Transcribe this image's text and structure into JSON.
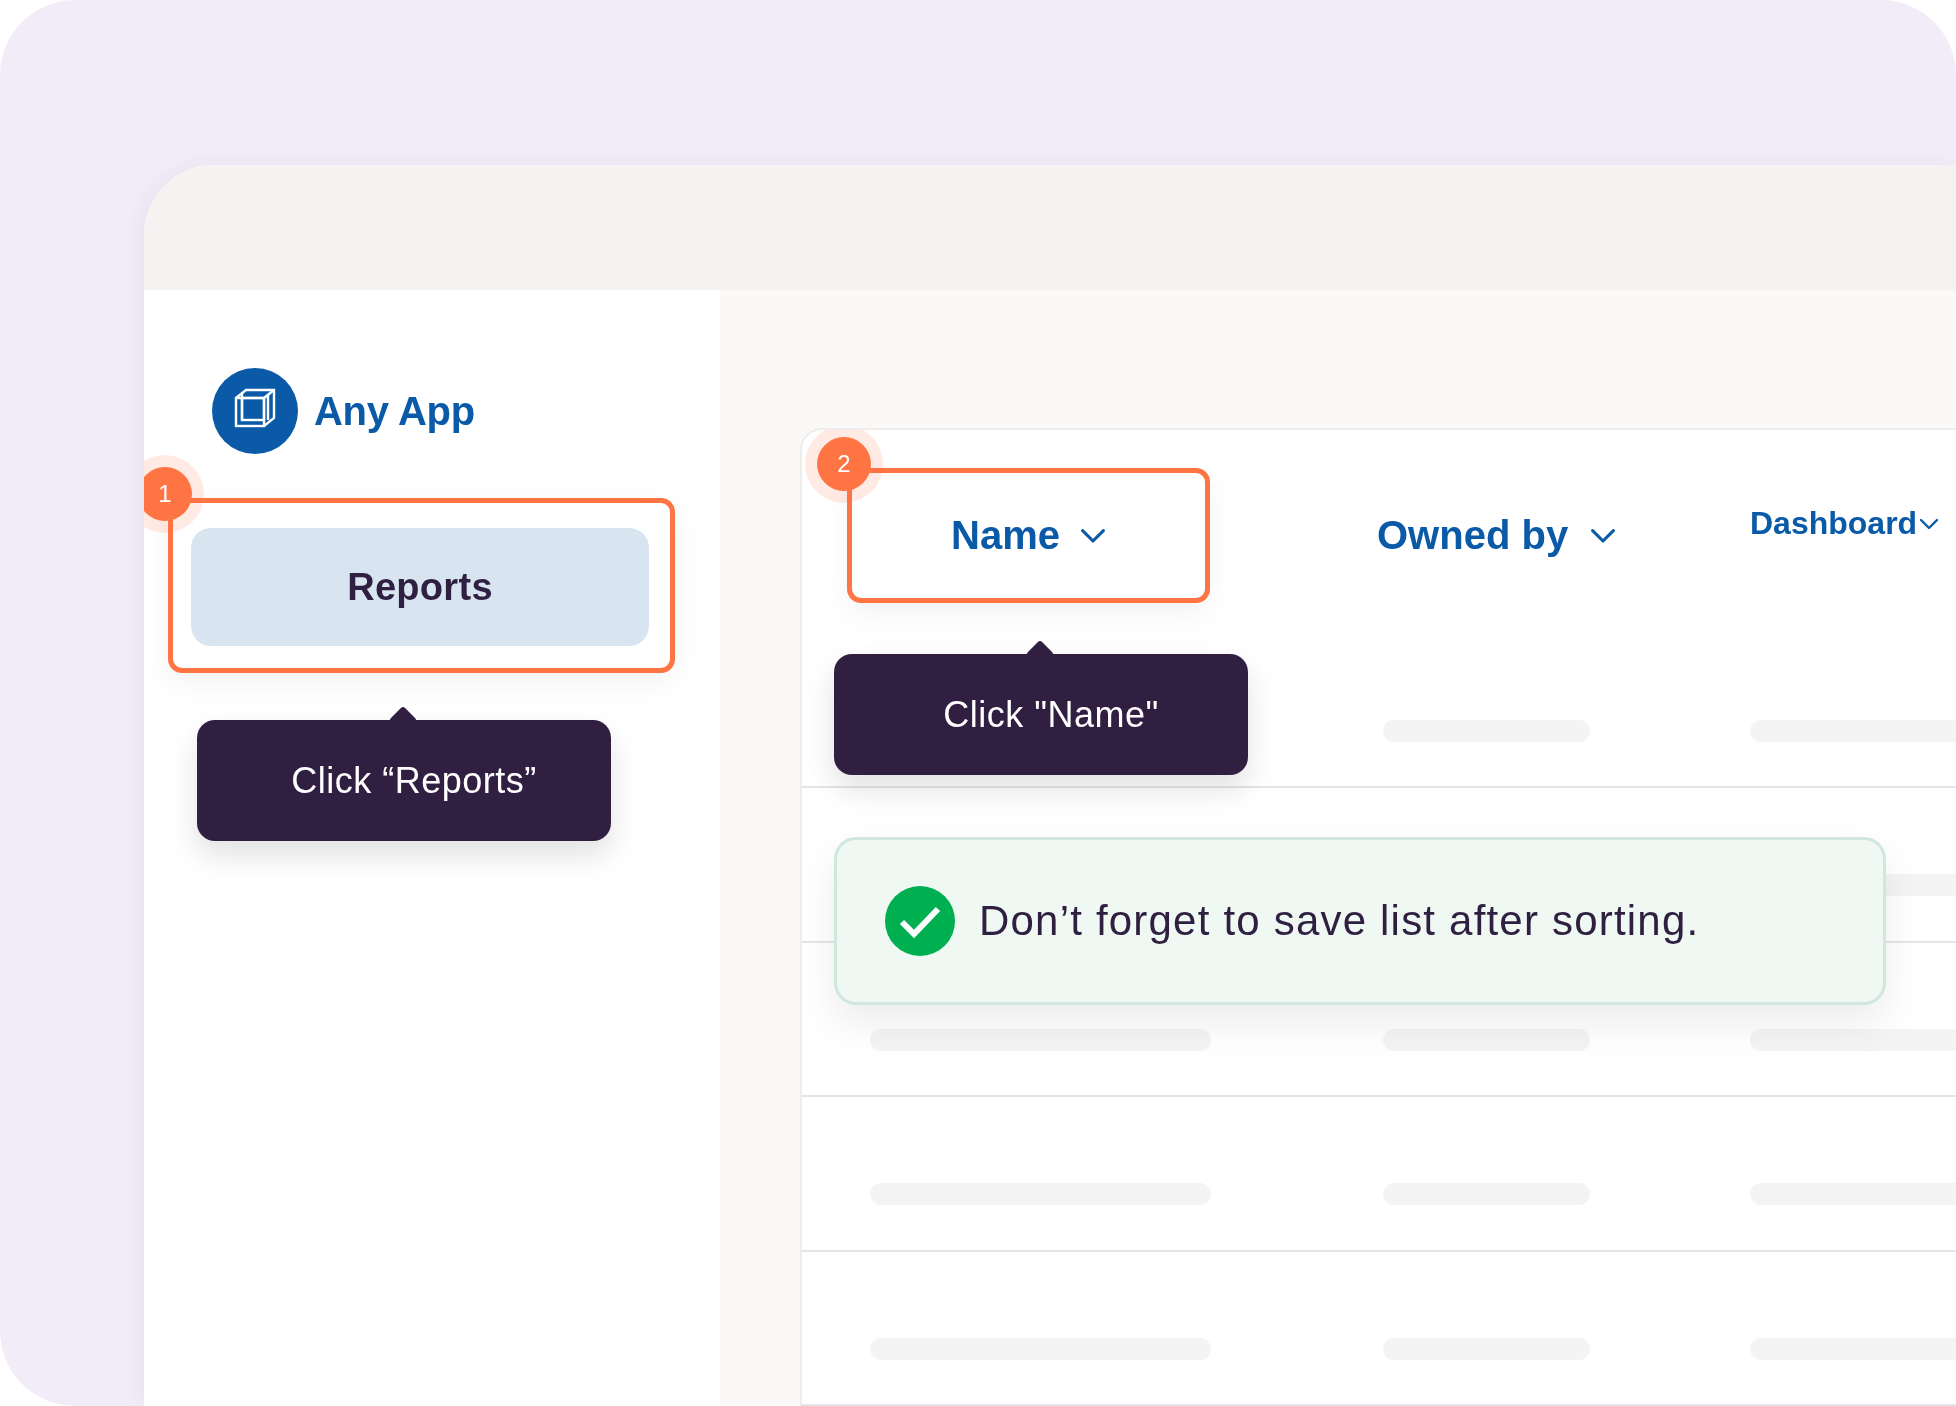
{
  "app": {
    "name": "Any App"
  },
  "sidebar": {
    "items": [
      {
        "label": "Reports",
        "selected": true
      }
    ]
  },
  "table": {
    "columns": [
      {
        "label": "Name"
      },
      {
        "label": "Owned by"
      },
      {
        "label": "Dashboard"
      }
    ]
  },
  "steps": [
    {
      "number": "1",
      "tip": "Click “Reports”"
    },
    {
      "number": "2",
      "tip": "Click \"Name\""
    }
  ],
  "toast": {
    "kind": "success",
    "message": "Don’t forget to save list after sorting."
  }
}
